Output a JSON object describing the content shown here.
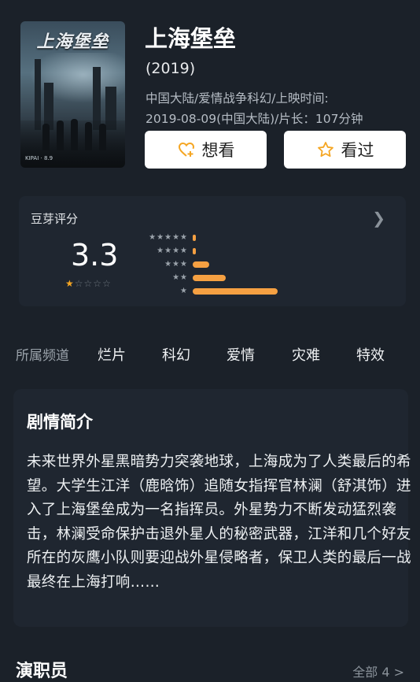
{
  "movie": {
    "title": "上海堡垒",
    "year": "(2019)",
    "meta_line1": "中国大陆/爱情战争科幻/上映时间:",
    "meta_line2": "2019-08-09(中国大陆)/片长：107分钟",
    "poster_title": "上海堡垒",
    "poster_tag": "KIPAI · 8.9"
  },
  "actions": {
    "want_label": "想看",
    "seen_label": "看过"
  },
  "rating": {
    "label": "豆芽评分",
    "score": "3.3",
    "score_stars": 1,
    "distribution": [
      {
        "stars": "★★★★★",
        "fraction": 0.04
      },
      {
        "stars": "★★★★",
        "fraction": 0.04
      },
      {
        "stars": "★★★",
        "fraction": 0.19
      },
      {
        "stars": "★★",
        "fraction": 0.39
      },
      {
        "stars": "★",
        "fraction": 1.0
      }
    ],
    "colors": {
      "accent": "#f5a042",
      "star_on": "#f5a623"
    }
  },
  "channels": {
    "label": "所属频道",
    "items": [
      "烂片",
      "科幻",
      "爱情",
      "灾难",
      "特效"
    ]
  },
  "synopsis": {
    "title": "剧情简介",
    "text": "未来世界外星黑暗势力突袭地球，上海成为了人类最后的希望。大学生江洋（鹿晗饰）追随女指挥官林澜（舒淇饰）进入了上海堡垒成为一名指挥员。外星势力不断发动猛烈袭击，林澜受命保护击退外星人的秘密武器，江洋和几个好友所在的灰鹰小队则要迎战外星侵略者，保卫人类的最后一战最终在上海打响……"
  },
  "cast": {
    "title": "演职员",
    "all_label": "全部 4 >"
  }
}
